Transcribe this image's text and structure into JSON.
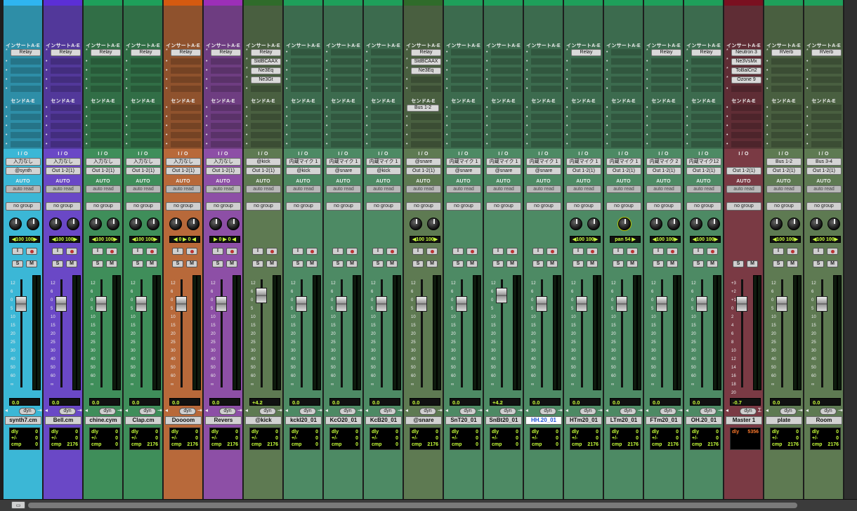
{
  "labels": {
    "inserts": "インサートA-E",
    "sends": "センドA-E",
    "io": "I / O",
    "auto": "AUTO",
    "dyn": "dyn",
    "i_btn": "I",
    "s_btn": "S",
    "m_btn": "M"
  },
  "meter_scale": [
    "12",
    "6",
    "0",
    "5",
    "10",
    "15",
    "20",
    "25",
    "30",
    "40",
    "50",
    "60",
    "∞"
  ],
  "meter_scale_db": [
    "0",
    "",
    "5",
    "",
    "10",
    "",
    "15",
    "",
    "20",
    "25",
    "30",
    "40",
    "∞"
  ],
  "master_scale": [
    "+3",
    "+2",
    "+1",
    "0",
    "2",
    "4",
    "6",
    "8",
    "10",
    "12",
    "14",
    "16",
    "18",
    "20"
  ],
  "scroll": {
    "size_button": "▭"
  },
  "strips": [
    {
      "name": "synth7.cm",
      "color": "#3bb7d6",
      "top": "#2fb5f0",
      "inserts": [
        "Relay"
      ],
      "send": "",
      "in": "入力なし",
      "out": "@synth",
      "auto": "auto read",
      "group": "no group",
      "pan": "◀100  100▶",
      "vol": "0.0",
      "info": [
        [
          "dly",
          "0"
        ],
        [
          "+/-",
          "0"
        ],
        [
          "cmp",
          "0"
        ]
      ],
      "fill": 0,
      "sel": false
    },
    {
      "name": "Bell.cm",
      "color": "#6a48c6",
      "top": "#5b2fd6",
      "inserts": [
        "Relay"
      ],
      "send": "",
      "in": "入力なし",
      "out": "Out 1-2(1)",
      "auto": "auto read",
      "group": "no group",
      "pan": "◀100  100▶",
      "vol": "0.0",
      "info": [
        [
          "dly",
          "0"
        ],
        [
          "+/-",
          "0"
        ],
        [
          "cmp",
          "2176"
        ]
      ],
      "fill": 0,
      "sel": false
    },
    {
      "name": "chine.cym",
      "color": "#3f8e5a",
      "top": "#1ea05a",
      "inserts": [
        "Relay"
      ],
      "send": "",
      "in": "入力なし",
      "out": "Out 1-2(1)",
      "auto": "auto read",
      "group": "no group",
      "pan": "◀100  100▶",
      "vol": "0.0",
      "info": [
        [
          "dly",
          "0"
        ],
        [
          "+/-",
          "0"
        ],
        [
          "cmp",
          "0"
        ]
      ],
      "fill": 0,
      "sel": false
    },
    {
      "name": "Clap.cm",
      "color": "#3f8e5a",
      "top": "#1ea05a",
      "inserts": [
        "Relay"
      ],
      "send": "",
      "in": "入力なし",
      "out": "Out 1-2(1)",
      "auto": "auto read",
      "group": "no group",
      "pan": "◀100  100▶",
      "vol": "0.0",
      "info": [
        [
          "dly",
          "0"
        ],
        [
          "+/-",
          "0"
        ],
        [
          "cmp",
          "2176"
        ]
      ],
      "fill": 0,
      "sel": false
    },
    {
      "name": "Doooom",
      "color": "#b8693a",
      "top": "#d55a10",
      "inserts": [
        "Relay"
      ],
      "send": "",
      "in": "入力なし",
      "out": "Out 1-2(1)",
      "auto": "auto read",
      "group": "no group",
      "pan": "◀ 0  ▶ 0 ◀",
      "vol": "0.0",
      "info": [
        [
          "dly",
          "0"
        ],
        [
          "+/-",
          "0"
        ],
        [
          "cmp",
          "2176"
        ]
      ],
      "fill": 0,
      "sel": false
    },
    {
      "name": "Revers",
      "color": "#8d4fa6",
      "top": "#9c2fb8",
      "inserts": [
        "Relay"
      ],
      "send": "",
      "in": "入力なし",
      "out": "Out 1-2(1)",
      "auto": "auto read",
      "group": "no group",
      "pan": "▶ 0  ▶ 0 ◀",
      "vol": "0.0",
      "info": [
        [
          "dly",
          "0"
        ],
        [
          "+/-",
          "0"
        ],
        [
          "cmp",
          "2176"
        ]
      ],
      "fill": 0,
      "sel": false
    },
    {
      "name": "@kick",
      "color": "#5e7a52",
      "top": "#2f6b2a",
      "inserts": [
        "Relay",
        "SldBCAAX",
        "Ne3Eq",
        "Ne3Gt"
      ],
      "send": "",
      "in": "@kick",
      "out": "Out 1-2(1)",
      "auto": "auto read",
      "group": "no group",
      "pan": "",
      "vol": "+4.2",
      "info": [
        [
          "dly",
          "0"
        ],
        [
          "+/-",
          "0"
        ],
        [
          "cmp",
          "2176"
        ]
      ],
      "fill": 0,
      "sel": false
    },
    {
      "name": "kckI20_01",
      "color": "#4d8a64",
      "top": "#1ea05a",
      "inserts": [],
      "send": "",
      "in": "内蔵マイク 1",
      "out": "@kick",
      "auto": "auto read",
      "group": "no group",
      "pan": "",
      "vol": "0.0",
      "info": [
        [
          "dly",
          "0"
        ],
        [
          "+/-",
          "0"
        ],
        [
          "cmp",
          "0"
        ]
      ],
      "fill": 0,
      "sel": false
    },
    {
      "name": "KcO20_01",
      "color": "#4d8a64",
      "top": "#1ea05a",
      "inserts": [],
      "send": "",
      "in": "内蔵マイク 1",
      "out": "@snare",
      "auto": "auto read",
      "group": "no group",
      "pan": "",
      "vol": "0.0",
      "info": [
        [
          "dly",
          "0"
        ],
        [
          "+/-",
          "0"
        ],
        [
          "cmp",
          "0"
        ]
      ],
      "fill": 0,
      "sel": false
    },
    {
      "name": "KcB20_01",
      "color": "#4d8a64",
      "top": "#1ea05a",
      "inserts": [],
      "send": "",
      "in": "内蔵マイク 1",
      "out": "@kick",
      "auto": "auto read",
      "group": "no group",
      "pan": "",
      "vol": "0.0",
      "info": [
        [
          "dly",
          "0"
        ],
        [
          "+/-",
          "0"
        ],
        [
          "cmp",
          "0"
        ]
      ],
      "fill": 0,
      "sel": false
    },
    {
      "name": "@snare",
      "color": "#5e7a52",
      "top": "#2f6b2a",
      "inserts": [
        "Relay",
        "SldBCAAX",
        "Ne3Eq"
      ],
      "send": "Bus 1-2",
      "in": "@snare",
      "out": "Out 1-2(1)",
      "auto": "auto read",
      "group": "no group",
      "pan": "◀100  100▶",
      "vol": "0.0",
      "info": [
        [
          "dly",
          "0"
        ],
        [
          "+/-",
          "0"
        ],
        [
          "cmp",
          "2176"
        ]
      ],
      "fill": 0,
      "sel": false
    },
    {
      "name": "SnT20_01",
      "color": "#4d8a64",
      "top": "#1ea05a",
      "inserts": [],
      "send": "",
      "in": "内蔵マイク 1",
      "out": "@snare",
      "auto": "auto read",
      "group": "no group",
      "pan": "",
      "vol": "0.0",
      "info": [
        [
          "dly",
          "0"
        ],
        [
          "+/-",
          "0"
        ],
        [
          "cmp",
          "0"
        ]
      ],
      "fill": 0,
      "sel": false
    },
    {
      "name": "SnBt20_01",
      "color": "#4d8a64",
      "top": "#1ea05a",
      "inserts": [],
      "send": "",
      "in": "内蔵マイク 1",
      "out": "@snare",
      "auto": "auto read",
      "group": "no group",
      "pan": "",
      "vol": "+4.2",
      "info": [
        [
          "dly",
          "0"
        ],
        [
          "+/-",
          "0"
        ],
        [
          "cmp",
          "0"
        ]
      ],
      "fill": 0,
      "sel": false
    },
    {
      "name": "HH.20_01",
      "color": "#4d8a64",
      "top": "#1ea05a",
      "inserts": [],
      "send": "",
      "in": "内蔵マイク 1",
      "out": "@snare",
      "auto": "auto read",
      "group": "no group",
      "pan": "",
      "vol": "0.0",
      "info": [
        [
          "dly",
          "0"
        ],
        [
          "+/-",
          "0"
        ],
        [
          "cmp",
          "0"
        ]
      ],
      "fill": 0,
      "sel": true
    },
    {
      "name": "HTm20_01",
      "color": "#4d8a64",
      "top": "#1ea05a",
      "inserts": [
        "Relay"
      ],
      "send": "",
      "in": "内蔵マイク 1",
      "out": "Out 1-2(1)",
      "auto": "auto read",
      "group": "no group",
      "pan": "◀100  100▶",
      "vol": "0.0",
      "info": [
        [
          "dly",
          "0"
        ],
        [
          "+/-",
          "0"
        ],
        [
          "cmp",
          "2176"
        ]
      ],
      "fill": 0,
      "sel": false
    },
    {
      "name": "LTm20_01",
      "color": "#4d8a64",
      "top": "#1ea05a",
      "inserts": [],
      "send": "",
      "in": "内蔵マイク 1",
      "out": "Out 1-2(1)",
      "auto": "auto read",
      "group": "no group",
      "pan": "pan  54 ▶",
      "vol": "0.0",
      "info": [
        [
          "dly",
          "0"
        ],
        [
          "+/-",
          "0"
        ],
        [
          "cmp",
          "2176"
        ]
      ],
      "fill": 0,
      "sel": false
    },
    {
      "name": "FTm20_01",
      "color": "#4d8a64",
      "top": "#1ea05a",
      "inserts": [
        "Relay"
      ],
      "send": "",
      "in": "内蔵マイク 2",
      "out": "Out 1-2(1)",
      "auto": "auto read",
      "group": "no group",
      "pan": "◀100  100▶",
      "vol": "0.0",
      "info": [
        [
          "dly",
          "0"
        ],
        [
          "+/-",
          "0"
        ],
        [
          "cmp",
          "2176"
        ]
      ],
      "fill": 0,
      "sel": false
    },
    {
      "name": "OH.20_01",
      "color": "#4d8a64",
      "top": "#1ea05a",
      "inserts": [
        "Relay"
      ],
      "send": "",
      "in": "内蔵マイク12",
      "out": "Out 1-2(1)",
      "auto": "auto read",
      "group": "no group",
      "pan": "◀100  100▶",
      "vol": "0.0",
      "info": [
        [
          "dly",
          "0"
        ],
        [
          "+/-",
          "0"
        ],
        [
          "cmp",
          "2176"
        ]
      ],
      "fill": 0,
      "sel": false
    },
    {
      "name": "Master 1",
      "color": "#7a3a44",
      "top": "#7a1020",
      "inserts": [
        "Neutron 3",
        "Ne3VsMx",
        "ToBalCn2",
        "Ozone 9"
      ],
      "send": "",
      "in": "",
      "out": "Out 1-2(1)",
      "auto": "auto read",
      "group": "no group",
      "pan": "",
      "vol": "-0.7",
      "info": [
        [
          "dly",
          "5356"
        ]
      ],
      "fill": 0,
      "sel": false
    },
    {
      "name": "plate",
      "color": "#5e7a52",
      "top": "#1ea05a",
      "inserts": [
        "RVerb"
      ],
      "send": "",
      "in": "Bus 1-2",
      "out": "Out 1-2(1)",
      "auto": "auto read",
      "group": "no group",
      "pan": "◀100  100▶",
      "vol": "0.0",
      "info": [
        [
          "dly",
          "0"
        ],
        [
          "+/-",
          "0"
        ],
        [
          "cmp",
          "2176"
        ]
      ],
      "fill": 0,
      "sel": false
    },
    {
      "name": "Room",
      "color": "#5e7a52",
      "top": "#1ea05a",
      "inserts": [
        "RVerb"
      ],
      "send": "",
      "in": "Bus 3-4",
      "out": "Out 1-2(1)",
      "auto": "auto read",
      "group": "no group",
      "pan": "◀100  100▶",
      "vol": "0.0",
      "info": [
        [
          "dly",
          "0"
        ],
        [
          "+/-",
          "0"
        ],
        [
          "cmp",
          "2176"
        ]
      ],
      "fill": 0,
      "sel": false
    }
  ]
}
